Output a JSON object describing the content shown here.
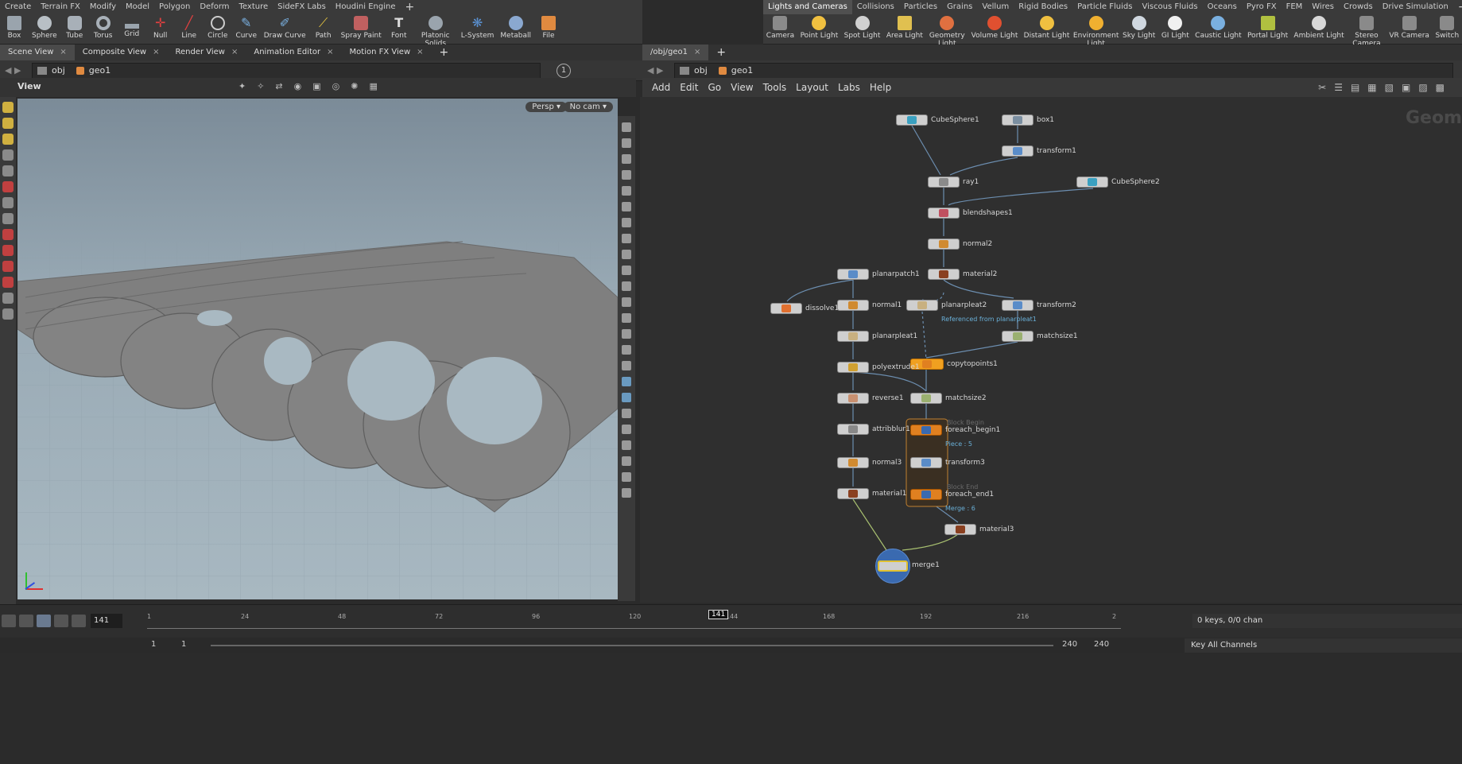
{
  "shelf_left": {
    "tabs": [
      "Create",
      "Terrain FX",
      "Modify",
      "Model",
      "Polygon",
      "Deform",
      "Texture",
      "SideFX Labs",
      "Houdini Engine"
    ],
    "tools": [
      "Box",
      "Sphere",
      "Tube",
      "Torus",
      "Grid",
      "Null",
      "Line",
      "Circle",
      "Curve",
      "Draw Curve",
      "Path",
      "Spray Paint",
      "Font",
      "Platonic Solids",
      "L-System",
      "Metaball",
      "File"
    ]
  },
  "shelf_right": {
    "tabs": [
      "Lights and Cameras",
      "Collisions",
      "Particles",
      "Grains",
      "Vellum",
      "Rigid Bodies",
      "Particle Fluids",
      "Viscous Fluids",
      "Oceans",
      "Pyro FX",
      "FEM",
      "Wires",
      "Crowds",
      "Drive Simulation"
    ],
    "tools": [
      "Camera",
      "Point Light",
      "Spot Light",
      "Area Light",
      "Geometry Light",
      "Volume Light",
      "Distant Light",
      "Environment Light",
      "Sky Light",
      "GI Light",
      "Caustic Light",
      "Portal Light",
      "Ambient Light",
      "Stereo Camera",
      "VR Camera",
      "Switch"
    ]
  },
  "pane_tabs": [
    "Scene View",
    "Composite View",
    "Render View",
    "Animation Editor",
    "Motion FX View"
  ],
  "left_path": {
    "obj": "obj",
    "geo": "geo1"
  },
  "viewport": {
    "title": "View",
    "persp": "Persp",
    "cam": "No cam"
  },
  "network": {
    "tab": "/obj/geo1",
    "path_obj": "obj",
    "path_geo": "geo1",
    "menu": [
      "Add",
      "Edit",
      "Go",
      "View",
      "Tools",
      "Layout",
      "Labs",
      "Help"
    ],
    "watermark": "Geom",
    "nodes": [
      {
        "name": "CubeSphere1",
        "color": "#3aa0c0"
      },
      {
        "name": "box1",
        "color": "#7a8ea0"
      },
      {
        "name": "transform1",
        "color": "#5a8cc8"
      },
      {
        "name": "ray1",
        "color": "#8a8a8a"
      },
      {
        "name": "CubeSphere2",
        "color": "#3aa0c0"
      },
      {
        "name": "blendshapes1",
        "color": "#c05060"
      },
      {
        "name": "normal2",
        "color": "#d08a30"
      },
      {
        "name": "material2",
        "color": "#8a4020"
      },
      {
        "name": "planarpatch1",
        "color": "#5a8cc8"
      },
      {
        "name": "dissolve1",
        "color": "#e07030"
      },
      {
        "name": "normal1",
        "color": "#d08a30"
      },
      {
        "name": "planarpleat2",
        "color": "#c8b080"
      },
      {
        "name": "transform2",
        "color": "#5a8cc8"
      },
      {
        "name": "planarpleat1",
        "color": "#c8b080"
      },
      {
        "name": "matchsize1",
        "color": "#9ab070"
      },
      {
        "name": "copytopoints1",
        "color": "#f0a020"
      },
      {
        "name": "polyextrude1",
        "color": "#d0a030"
      },
      {
        "name": "reverse1",
        "color": "#c89070"
      },
      {
        "name": "matchsize2",
        "color": "#9ab070"
      },
      {
        "name": "foreach_begin1",
        "color": "#e08020"
      },
      {
        "name": "attribblur1",
        "color": "#888888"
      },
      {
        "name": "transform3",
        "color": "#5a8cc8"
      },
      {
        "name": "normal3",
        "color": "#d08a30"
      },
      {
        "name": "foreach_end1",
        "color": "#e08020"
      },
      {
        "name": "material1",
        "color": "#8a4020"
      },
      {
        "name": "material3",
        "color": "#8a4020"
      },
      {
        "name": "merge1",
        "color": "#3a6ab0"
      }
    ],
    "annotations": {
      "ref": "Referenced from planarpleat1",
      "block_begin": "Block Begin",
      "piece": "Piece : 5",
      "block_end": "Block End",
      "merge": "Merge : 6"
    }
  },
  "timeline": {
    "current_frame": "141",
    "marker": "141",
    "ticks": [
      "1",
      "24",
      "48",
      "72",
      "96",
      "120",
      "144",
      "168",
      "192",
      "216",
      "2"
    ],
    "start": "1",
    "start2": "1",
    "end": "240",
    "end2": "240",
    "keys": "0 keys, 0/0 chan",
    "key_all": "Key All Channels"
  },
  "colors": {
    "accent": "#f0a020",
    "network_bg": "#2f2f2f",
    "panel": "#3a3a3a"
  }
}
